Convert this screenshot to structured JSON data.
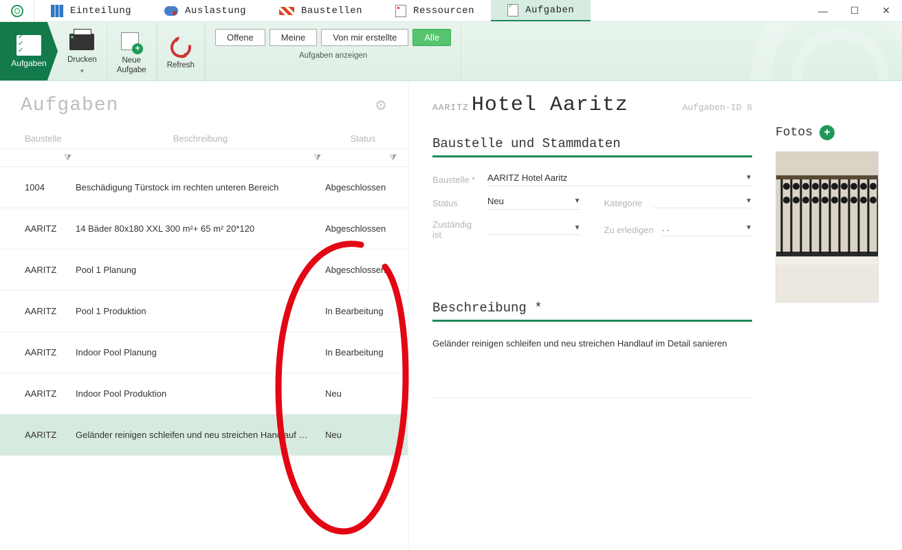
{
  "top_tabs": {
    "einteilung": "Einteilung",
    "auslastung": "Auslastung",
    "baustellen": "Baustellen",
    "ressourcen": "Ressourcen",
    "aufgaben": "Aufgaben"
  },
  "ribbon": {
    "aufgaben": "Aufgaben",
    "drucken": "Drucken",
    "neue_aufgabe": "Neue\nAufgabe",
    "refresh": "Refresh",
    "filter": {
      "offene": "Offene",
      "meine": "Meine",
      "von_mir": "Von mir erstellte",
      "alle": "Alle"
    },
    "group_label": "Aufgaben anzeigen"
  },
  "left": {
    "title": "Aufgaben",
    "columns": {
      "baustelle": "Baustelle",
      "beschreibung": "Beschreibung",
      "status": "Status"
    },
    "rows": [
      {
        "bau": "1004",
        "besch": "Beschädigung Türstock im rechten unteren Bereich",
        "stat": "Abgeschlossen"
      },
      {
        "bau": "AARITZ",
        "besch": "14 Bäder 80x180 XXL 300 m²+ 65 m² 20*120",
        "stat": "Abgeschlossen"
      },
      {
        "bau": "AARITZ",
        "besch": "Pool 1 Planung",
        "stat": "Abgeschlossen"
      },
      {
        "bau": "AARITZ",
        "besch": "Pool 1 Produktion",
        "stat": "In Bearbeitung"
      },
      {
        "bau": "AARITZ",
        "besch": "Indoor Pool Planung",
        "stat": "In Bearbeitung"
      },
      {
        "bau": "AARITZ",
        "besch": "Indoor Pool Produktion",
        "stat": "Neu"
      },
      {
        "bau": "AARITZ",
        "besch": "Geländer reinigen schleifen und neu streichen Handlauf im Detail sanieren",
        "stat": "Neu"
      }
    ]
  },
  "right": {
    "prefix": "AARITZ",
    "title": "Hotel Aaritz",
    "task_id": "Aufgaben-ID 8",
    "section_stammdaten": "Baustelle und Stammdaten",
    "labels": {
      "baustelle": "Baustelle *",
      "status": "Status",
      "kategorie": "Kategorie",
      "zustaendig": "Zuständig ist",
      "erledigen": "Zu erledigen bis"
    },
    "values": {
      "baustelle": "AARITZ Hotel Aaritz",
      "status": "Neu",
      "erledigen": ". ."
    },
    "section_beschreibung": "Beschreibung *",
    "description": "Geländer reinigen schleifen und neu streichen Handlauf im Detail sanieren",
    "fotos_label": "Fotos"
  }
}
